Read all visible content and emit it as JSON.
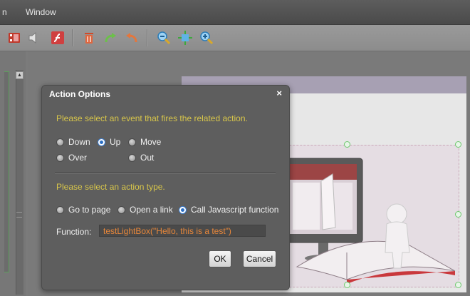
{
  "menu": {
    "partial_item": "n",
    "window": "Window"
  },
  "toolbar": {
    "icons": [
      "filmstrip-icon",
      "speaker-icon",
      "flash-icon",
      "trash-icon",
      "redo-icon",
      "undo-icon",
      "zoom-out-icon",
      "fit-icon",
      "zoom-in-icon"
    ]
  },
  "dialog": {
    "title": "Action Options",
    "close": "×",
    "event_prompt": "Please select an event that fires the related action.",
    "events": {
      "down": "Down",
      "up": "Up",
      "move": "Move",
      "over": "Over",
      "out": "Out"
    },
    "selected_event": "Up",
    "action_prompt": "Please select an action type.",
    "actions": {
      "go_to_page": "Go to page",
      "open_link": "Open a link",
      "call_js": "Call Javascript function"
    },
    "selected_action": "Call Javascript function",
    "function_label": "Function:",
    "function_value": "testLightBox(\"Hello, this is a test\")",
    "ok": "OK",
    "cancel": "Cancel"
  },
  "colors": {
    "prompt": "#d8c64a",
    "function_text": "#e8873a",
    "selection": "#2b6fc5"
  }
}
